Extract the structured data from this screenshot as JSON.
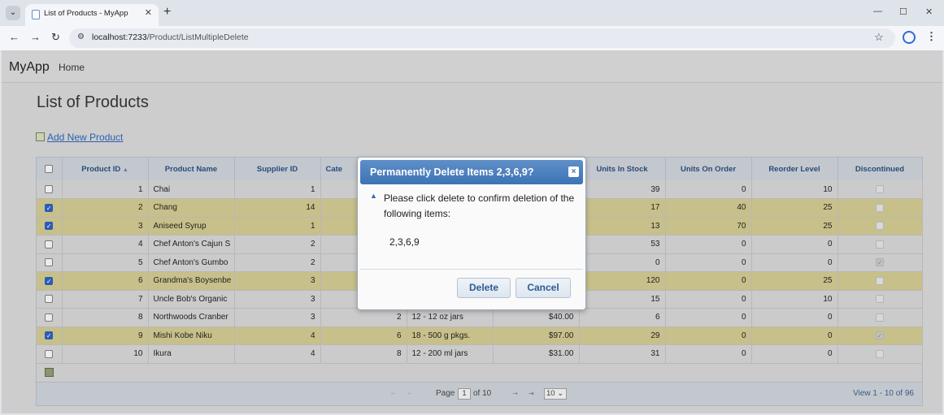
{
  "browser": {
    "tab_title": "List of Products - MyApp",
    "url_host": "localhost:7233",
    "url_path": "/Product/ListMultipleDelete"
  },
  "app": {
    "brand": "MyApp",
    "nav_home": "Home",
    "page_title": "List of Products",
    "add_link": "Add New Product"
  },
  "grid": {
    "columns": [
      "Product ID",
      "Product Name",
      "Supplier ID",
      "Cate",
      "",
      "",
      "Units In Stock",
      "Units On Order",
      "Reorder Level",
      "Discontinued"
    ],
    "rows": [
      {
        "selected": false,
        "id": "1",
        "name": "Chai",
        "supplier": "1",
        "category": "",
        "qty": "",
        "price": "",
        "stock": "39",
        "order": "0",
        "reorder": "10",
        "disc": false
      },
      {
        "selected": true,
        "id": "2",
        "name": "Chang",
        "supplier": "14",
        "category": "",
        "qty": "",
        "price": "",
        "stock": "17",
        "order": "40",
        "reorder": "25",
        "disc": false
      },
      {
        "selected": true,
        "id": "3",
        "name": "Aniseed Syrup",
        "supplier": "1",
        "category": "",
        "qty": "",
        "price": "",
        "stock": "13",
        "order": "70",
        "reorder": "25",
        "disc": false
      },
      {
        "selected": false,
        "id": "4",
        "name": "Chef Anton's Cajun S",
        "supplier": "2",
        "category": "",
        "qty": "",
        "price": "",
        "stock": "53",
        "order": "0",
        "reorder": "0",
        "disc": false
      },
      {
        "selected": false,
        "id": "5",
        "name": "Chef Anton's Gumbo",
        "supplier": "2",
        "category": "",
        "qty": "",
        "price": "",
        "stock": "0",
        "order": "0",
        "reorder": "0",
        "disc": true
      },
      {
        "selected": true,
        "id": "6",
        "name": "Grandma's Boysenbe",
        "supplier": "3",
        "category": "",
        "qty": "",
        "price": "",
        "stock": "120",
        "order": "0",
        "reorder": "25",
        "disc": false
      },
      {
        "selected": false,
        "id": "7",
        "name": "Uncle Bob's Organic",
        "supplier": "3",
        "category": "",
        "qty": "",
        "price": "",
        "stock": "15",
        "order": "0",
        "reorder": "10",
        "disc": false
      },
      {
        "selected": false,
        "id": "8",
        "name": "Northwoods Cranber",
        "supplier": "3",
        "category": "2",
        "qty": "12 - 12 oz jars",
        "price": "$40.00",
        "stock": "6",
        "order": "0",
        "reorder": "0",
        "disc": false
      },
      {
        "selected": true,
        "id": "9",
        "name": "Mishi Kobe Niku",
        "supplier": "4",
        "category": "6",
        "qty": "18 - 500 g pkgs.",
        "price": "$97.00",
        "stock": "29",
        "order": "0",
        "reorder": "0",
        "disc": true
      },
      {
        "selected": false,
        "id": "10",
        "name": "Ikura",
        "supplier": "4",
        "category": "8",
        "qty": "12 - 200 ml jars",
        "price": "$31.00",
        "stock": "31",
        "order": "0",
        "reorder": "0",
        "disc": false
      }
    ]
  },
  "pager": {
    "page_label": "Page",
    "page_value": "1",
    "of_label": "of 10",
    "page_size": "10",
    "view_text": "View 1 - 10 of 96"
  },
  "dialog": {
    "title": "Permanently Delete Items 2,3,6,9?",
    "close": "×",
    "message": "Please click delete to confirm deletion of the following items:",
    "items": "2,3,6,9",
    "delete_label": "Delete",
    "cancel_label": "Cancel"
  },
  "colors": {
    "selected_row": "#c8c08a",
    "dialog_header": "#3d73b5",
    "link": "#2b5fb0"
  }
}
